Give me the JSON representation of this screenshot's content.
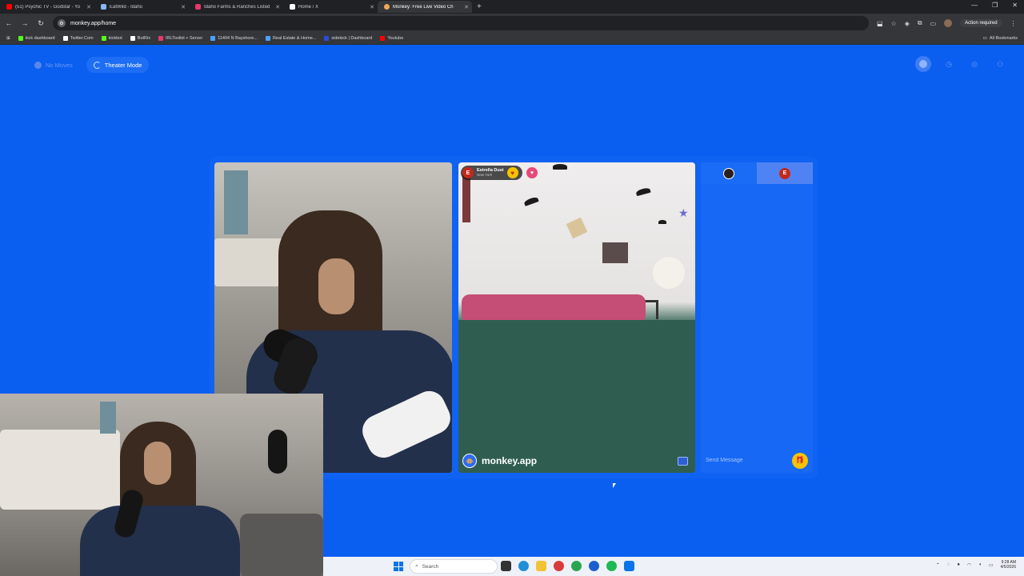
{
  "browser": {
    "tabs": [
      {
        "title": "(51) Psychic TV - Godstar - Yo",
        "icon": "youtube-icon",
        "color": "#ff0000"
      },
      {
        "title": "EatWild - Idaho",
        "icon": "page-icon",
        "color": "#8ab4f8"
      },
      {
        "title": "Idaho Farms & Ranches Listed",
        "icon": "pin-icon",
        "color": "#e5396a"
      },
      {
        "title": "Home / X",
        "icon": "x-icon",
        "color": "#ffffff"
      },
      {
        "title": "Monkey: Free Live Video Ch",
        "icon": "monkey-icon",
        "color": "#f2a65a",
        "active": true
      }
    ],
    "url": "monkey.app/home",
    "action_required": "Action required",
    "bookmarks": [
      {
        "label": "kick dashboard",
        "color": "#53fc18"
      },
      {
        "label": "Twitter.Com",
        "color": "#ffffff"
      },
      {
        "label": "kickbot",
        "color": "#53fc18"
      },
      {
        "label": "BotRix",
        "color": "#ffffff"
      },
      {
        "label": "IRLToolkit + Server",
        "color": "#e5396a"
      },
      {
        "label": "11404 N Bayshore...",
        "color": "#4aa3ff"
      },
      {
        "label": "Real Estate & Home...",
        "color": "#4aa3ff"
      },
      {
        "label": "sidekick | Dashboard",
        "color": "#2b4bd8"
      },
      {
        "label": "Youtube",
        "color": "#ff0000"
      }
    ],
    "all_bookmarks": "All Bookmarks"
  },
  "app": {
    "no_moves": "No Moves",
    "theater_mode": "Theater Mode"
  },
  "peer": {
    "name": "Estrella Dust",
    "location": "New York",
    "avatar_letter": "E"
  },
  "watermark": "monkey.app",
  "chat": {
    "placeholder": "Send Message",
    "peer_letter": "E"
  },
  "taskbar": {
    "search": "Search",
    "time": "9:28 AM",
    "date": "4/5/2026"
  },
  "colors": {
    "page_bg": "#0a5ff0",
    "accent": "#1668f5",
    "gift": "#f5c400"
  }
}
